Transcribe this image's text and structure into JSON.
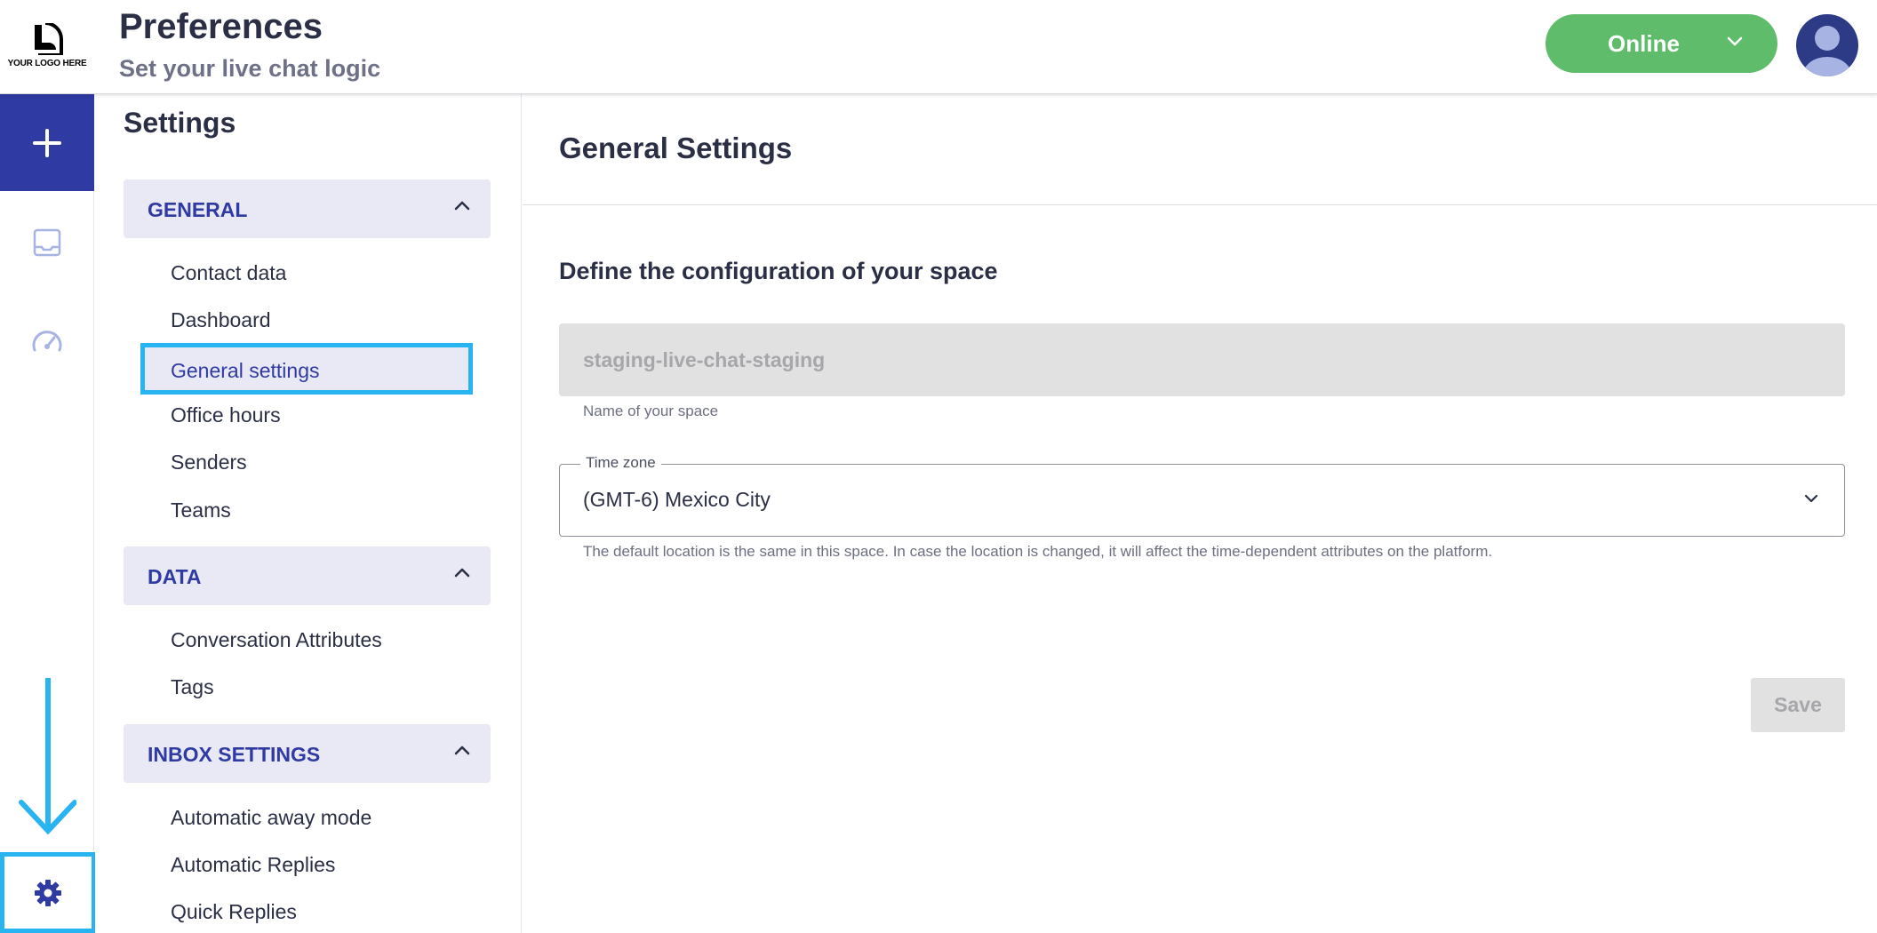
{
  "header": {
    "logo_text": "YOUR LOGO HERE",
    "title": "Preferences",
    "subtitle": "Set your live chat logic",
    "status": {
      "label": "Online",
      "color": "#5ebc6a"
    }
  },
  "rail": {
    "items": [
      {
        "icon": "plus-icon"
      },
      {
        "icon": "inbox-icon"
      },
      {
        "icon": "dashboard-gauge-icon"
      },
      {
        "icon": "gear-icon"
      }
    ],
    "accent": "#2f3aa3"
  },
  "nav": {
    "title": "Settings",
    "sections": [
      {
        "label": "GENERAL",
        "items": [
          "Contact data",
          "Dashboard",
          "General settings",
          "Office hours",
          "Senders",
          "Teams"
        ],
        "selected": "General settings"
      },
      {
        "label": "DATA",
        "items": [
          "Conversation Attributes",
          "Tags"
        ]
      },
      {
        "label": "INBOX SETTINGS",
        "items": [
          "Automatic away mode",
          "Automatic Replies",
          "Quick Replies"
        ]
      }
    ]
  },
  "main": {
    "title": "General Settings",
    "section_title": "Define the configuration of your space",
    "space_name": {
      "value": "staging-live-chat-staging",
      "helper": "Name of your space"
    },
    "timezone": {
      "label": "Time zone",
      "value": "(GMT-6) Mexico City",
      "helper": "The default location is the same in this space. In case the location is changed, it will affect the time-dependent attributes on the platform."
    },
    "save_label": "Save"
  },
  "highlight_color": "#27b4f1"
}
